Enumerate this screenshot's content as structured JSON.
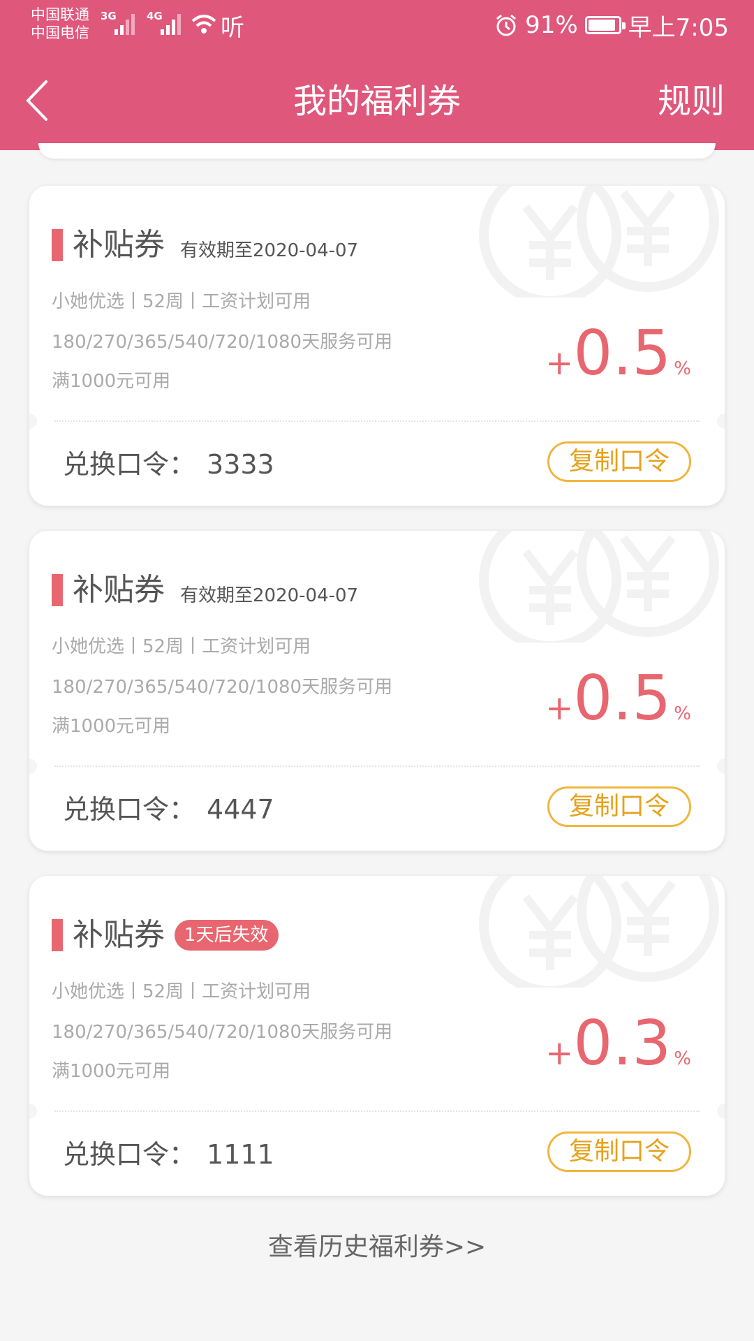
{
  "status_bar": {
    "carrier_1": "中国联通",
    "carrier_2": "中国电信",
    "net_1": "3G",
    "net_2": "4G",
    "app_mark": "听",
    "battery_text": "91%",
    "battery_level": 0.91,
    "time": "早上7:05"
  },
  "header": {
    "title": "我的福利券",
    "rules_label": "规则",
    "bg_color": "#e0577c"
  },
  "coupons": [
    {
      "name": "补贴券",
      "validity": "有效期至2020-04-07",
      "badge": "",
      "line1": "小她优选丨52周丨工资计划可用",
      "line2": "180/270/365/540/720/1080天服务可用",
      "line3": "满1000元可用",
      "rate_sign": "+",
      "rate": "0.5",
      "rate_unit": "%",
      "code_label": "兑换口令：",
      "code": "3333",
      "copy_label": "复制口令"
    },
    {
      "name": "补贴券",
      "validity": "有效期至2020-04-07",
      "badge": "",
      "line1": "小她优选丨52周丨工资计划可用",
      "line2": "180/270/365/540/720/1080天服务可用",
      "line3": "满1000元可用",
      "rate_sign": "+",
      "rate": "0.5",
      "rate_unit": "%",
      "code_label": "兑换口令：",
      "code": "4447",
      "copy_label": "复制口令"
    },
    {
      "name": "补贴券",
      "validity": "",
      "badge": "1天后失效",
      "line1": "小她优选丨52周丨工资计划可用",
      "line2": "180/270/365/540/720/1080天服务可用",
      "line3": "满1000元可用",
      "rate_sign": "+",
      "rate": "0.3",
      "rate_unit": "%",
      "code_label": "兑换口令：",
      "code": "1111",
      "copy_label": "复制口令"
    }
  ],
  "history_link": "查看历史福利券>>",
  "colors": {
    "accent": "#e8666f",
    "copy_button": "#f0b63d"
  },
  "icons": [
    "back-arrow-icon",
    "signal-icon",
    "wifi-icon",
    "alarm-icon",
    "battery-icon",
    "yuan-coin-icon"
  ]
}
